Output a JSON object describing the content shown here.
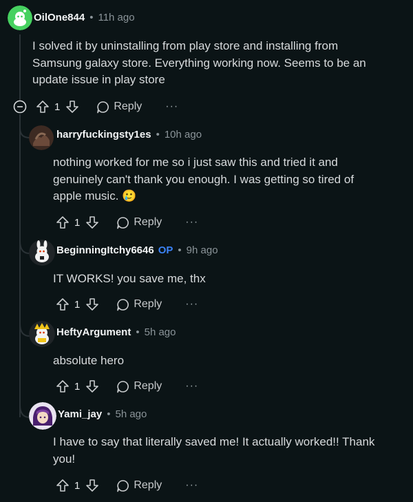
{
  "comments": [
    {
      "username": "OilOne844",
      "op_badge": "",
      "time": "11h ago",
      "body": "I solved it by uninstalling from play store and installing from\nSamsung galaxy store. Everything working now. Seems to be an\nupdate issue in play store",
      "votes": "1",
      "reply_label": "Reply",
      "more_label": "···",
      "avatar_color": "#46d160"
    },
    {
      "username": "harryfuckingsty1es",
      "op_badge": "",
      "time": "10h ago",
      "body": "nothing worked for me so i just saw this and tried it and\ngenuinely can't thank you enough. I was getting so tired of\napple music. 🥲",
      "votes": "1",
      "reply_label": "Reply",
      "more_label": "···",
      "avatar_color": "#6b4a3a"
    },
    {
      "username": "BeginningItchy6646",
      "op_badge": "OP",
      "time": "9h ago",
      "body": "IT WORKS! you save me, thx",
      "votes": "1",
      "reply_label": "Reply",
      "more_label": "···",
      "avatar_color": "#e8e8e8"
    },
    {
      "username": "HeftyArgument",
      "op_badge": "",
      "time": "5h ago",
      "body": "absolute hero",
      "votes": "1",
      "reply_label": "Reply",
      "more_label": "···",
      "avatar_color": "#f0c419"
    },
    {
      "username": "Yami_jay",
      "op_badge": "",
      "time": "5h ago",
      "body": "I have to say that literally saved me! It actually worked!! Thank\nyou!",
      "votes": "1",
      "reply_label": "Reply",
      "more_label": "···",
      "avatar_color": "#7b3fa0"
    }
  ],
  "separator": "•",
  "colors": {
    "background": "#0b1416",
    "op": "#3b82f6",
    "muted": "#8b9499"
  }
}
